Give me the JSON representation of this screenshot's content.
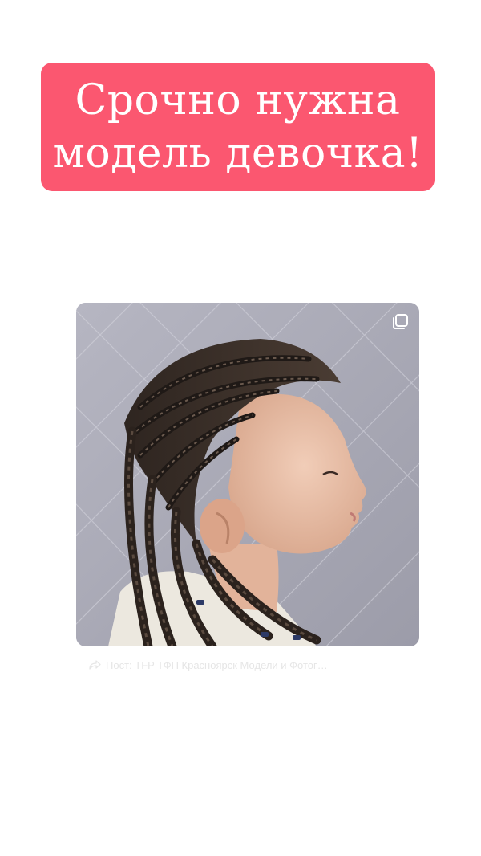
{
  "banner": {
    "line1": "Срочно нужна",
    "line2": "модель девочка!",
    "color": "#fb5770"
  },
  "post": {
    "image_icon": "hair-braids-photo",
    "multi_icon": "multiple-photos-icon",
    "caption": "Пост: TFP ТФП Красноярск  Модели и Фотог…",
    "caption_icon": "share-arrow-icon"
  }
}
